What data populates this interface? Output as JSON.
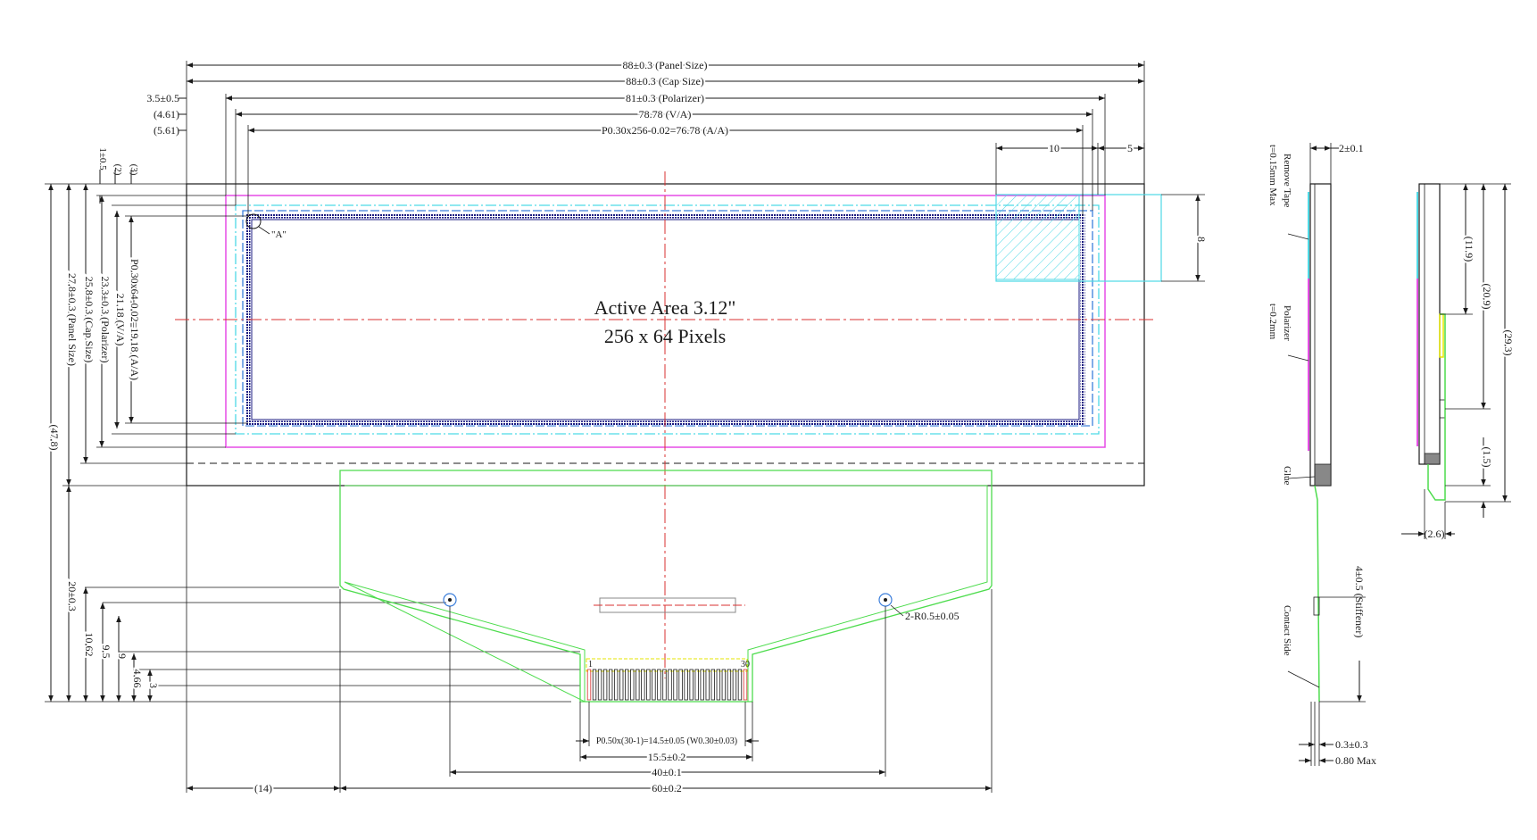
{
  "drawing": {
    "active_area_line1": "Active Area 3.12\"",
    "active_area_line2": "256 x 64 Pixels",
    "detail_marker": "\"A\"",
    "colors": {
      "outline": "#1a1a1a",
      "polarizer": "#e64ce6",
      "cap": "#4dd9e6",
      "va": "#3d7fdb",
      "aa": "#1a1a80",
      "fpc": "#4ddc4d",
      "center": "#d93030",
      "stiffener": "#e6e600"
    }
  },
  "dims_top": {
    "panel": "88±0.3 (Panel Size)",
    "cap": "88±0.3 (Cap Size)",
    "pol": "81±0.3 (Polarizer)",
    "va": "78.78 (V/A)",
    "aa": "P0.30x256-0.02=76.78 (A/A)",
    "pol_off": "3.5±0.5",
    "va_off": "(4.61)",
    "aa_off": "(5.61)",
    "ten": "10",
    "five": "5",
    "eight": "8"
  },
  "dims_left": {
    "one": "1±0.5",
    "two": "(2)",
    "three": "(3)",
    "aa": "P0.30x64-0.02=19.18 (A/A)",
    "va": "21.18 (V/A)",
    "pol": "23.3±0.3 (Polarizer)",
    "cap": "25.8±0.3 (Cap Size)",
    "panel": "27.8±0.3 (Panel Size)",
    "total": "(47.8)",
    "fpc20": "20±0.3",
    "d1062": "10.62",
    "d95": "9.5",
    "d9": "9",
    "d466": "4.66",
    "d3": "3"
  },
  "dims_bottom": {
    "pitch": "P0.50x(30-1)=14.5±0.05 (W0.30±0.03)",
    "w155": "15.5±0.2",
    "w40": "40±0.1",
    "w14": "(14)",
    "w60": "60±0.2",
    "radius": "2-R0.5±0.05",
    "pin1": "1",
    "pin30": "30"
  },
  "side_view": {
    "thickness": "2±0.1",
    "remove_tape": "Remove Tape",
    "tape_thick": "t=0.15mm Max",
    "polarizer": "Polarizer",
    "pol_thick": "t=0.2mm",
    "glue": "Glue",
    "stiffener": "4±0.5 (Stiffener)",
    "contact": "Contact Side",
    "t03": "0.3±0.3",
    "t08": "0.80 Max"
  },
  "side_view2": {
    "d119": "(11.9)",
    "d209": "(20.9)",
    "d293": "(29.3)",
    "d15": "(1.5)",
    "d26": "(2.6)"
  }
}
